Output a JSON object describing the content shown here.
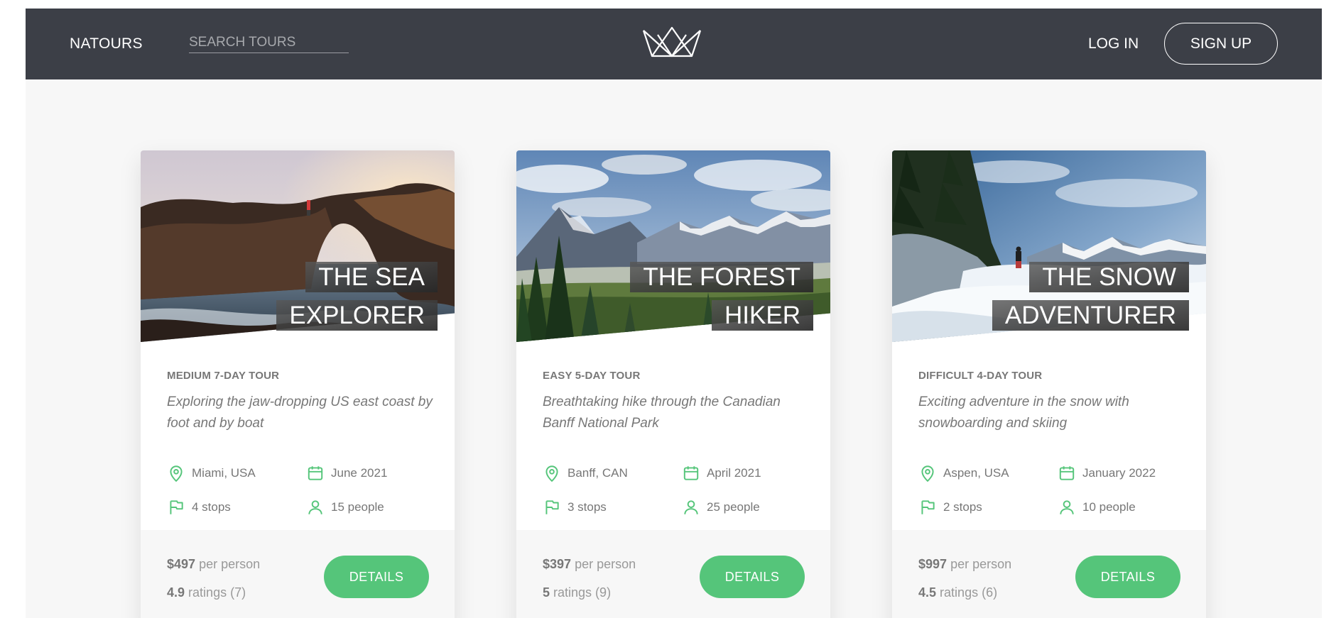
{
  "header": {
    "brand": "NATOURS",
    "search_placeholder": "SEARCH TOURS",
    "logo_icon": "crown-logo-icon",
    "login": "LOG IN",
    "signup": "SIGN UP"
  },
  "colors": {
    "header_bg": "#3c3f47",
    "accent_green": "#55c57a",
    "page_bg": "#f7f7f7"
  },
  "tours": [
    {
      "name_line1": "THE SEA",
      "name_line2": "EXPLORER",
      "difficulty": "MEDIUM 7-DAY TOUR",
      "summary": "Exploring the jaw-dropping US east coast by foot and by boat",
      "location": "Miami, USA",
      "date": "June 2021",
      "stops": "4 stops",
      "people": "15 people",
      "price": "$497",
      "price_suffix": "per person",
      "rating": "4.9",
      "rating_suffix": "ratings (7)",
      "button": "DETAILS"
    },
    {
      "name_line1": "THE FOREST",
      "name_line2": "HIKER",
      "difficulty": "EASY 5-DAY TOUR",
      "summary": "Breathtaking hike through the Canadian Banff National Park",
      "location": "Banff, CAN",
      "date": "April 2021",
      "stops": "3 stops",
      "people": "25 people",
      "price": "$397",
      "price_suffix": "per person",
      "rating": "5",
      "rating_suffix": "ratings (9)",
      "button": "DETAILS"
    },
    {
      "name_line1": "THE SNOW",
      "name_line2": "ADVENTURER",
      "difficulty": "DIFFICULT 4-DAY TOUR",
      "summary": "Exciting adventure in the snow with snowboarding and skiing",
      "location": "Aspen, USA",
      "date": "January 2022",
      "stops": "2 stops",
      "people": "10 people",
      "price": "$997",
      "price_suffix": "per person",
      "rating": "4.5",
      "rating_suffix": "ratings (6)",
      "button": "DETAILS"
    }
  ],
  "detail_icons": [
    "map-pin-icon",
    "calendar-icon",
    "flag-icon",
    "user-icon"
  ]
}
